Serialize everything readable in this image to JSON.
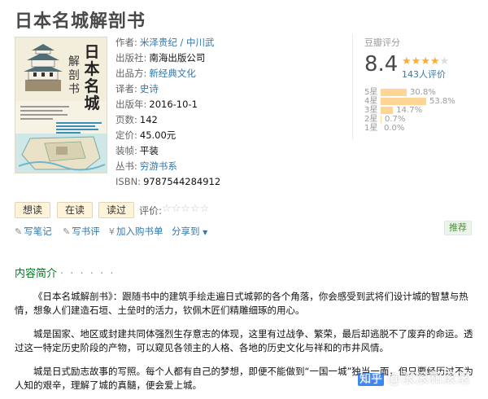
{
  "book": {
    "title": "日本名城解剖书",
    "cover": {
      "title_main": "日本名城",
      "title_sub": "解剖书"
    },
    "info": [
      {
        "label": "作者:",
        "value": "米泽贵纪 / 中川武",
        "link": true
      },
      {
        "label": "出版社:",
        "value": "南海出版公司",
        "link": false
      },
      {
        "label": "出品方:",
        "value": "新经典文化",
        "link": true
      },
      {
        "label": "译者:",
        "value": "史诗",
        "link": true
      },
      {
        "label": "出版年:",
        "value": "2016-10-1",
        "link": false
      },
      {
        "label": "页数:",
        "value": "142",
        "link": false
      },
      {
        "label": "定价:",
        "value": "45.00元",
        "link": false
      },
      {
        "label": "装帧:",
        "value": "平装",
        "link": false
      },
      {
        "label": "丛书:",
        "value": "穷游书系",
        "link": true
      },
      {
        "label": "ISBN:",
        "value": "9787544284912",
        "link": false
      }
    ]
  },
  "rating": {
    "title": "豆瓣评分",
    "score": "8.4",
    "stars_filled": 4,
    "stars_total": 5,
    "count_text": "143人评价",
    "distribution": [
      {
        "label": "5星",
        "pct_text": "30.8%",
        "pct": 30.8
      },
      {
        "label": "4星",
        "pct_text": "53.8%",
        "pct": 53.8
      },
      {
        "label": "3星",
        "pct_text": "14.7%",
        "pct": 14.7
      },
      {
        "label": "2星",
        "pct_text": "0.7%",
        "pct": 0.7
      },
      {
        "label": "1星",
        "pct_text": "0.0%",
        "pct": 0.0
      }
    ]
  },
  "status_buttons": [
    "想读",
    "在读",
    "读过"
  ],
  "user_rating": {
    "label": "评价:",
    "stars": "☆☆☆☆☆"
  },
  "actions": {
    "write_note": "写笔记",
    "write_review": "写书评",
    "add_cart": "加入购书单",
    "share": "分享到",
    "share_arrow": "▼",
    "recommend": "推荐"
  },
  "intro": {
    "heading": "内容简介",
    "dots": "· · · · · ·",
    "paragraphs": [
      "《日本名城解剖书》：跟随书中的建筑手绘走遍日式城郭的各个角落，你会感受到武将们设计城的智慧与热情，想象人们建造石垣、土垒时的活力，钦佩木匠们精雕细琢的用心。",
      "城是国家、地区或封建共同体强烈生存意志的体现，这里有过战争、繁荣，最后却逃脱不了废弃的命运。透过这一特定历史阶段的产物，可以窥见各领主的人格、各地的历史文化与祥和的市井风情。",
      "城是日式励志故事的写照。每个人都有自己的梦想，即便不能做到“一国一城”独当一面，但只要经历过不为人知的艰辛，理解了城的真髓，便会爱上城。"
    ]
  },
  "watermark": {
    "brand": "知乎",
    "text": "@滚滚和滚滚"
  },
  "colors": {
    "link": "#3377aa",
    "star": "#ffac2d",
    "bar": "#ffd596",
    "heading": "#007722"
  }
}
